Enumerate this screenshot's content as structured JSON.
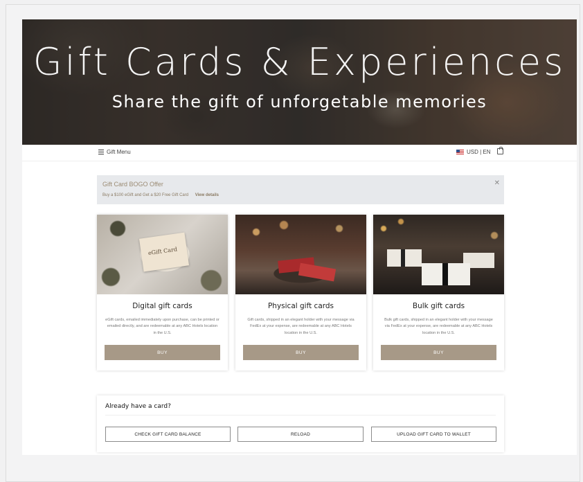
{
  "hero": {
    "title": "Gift Cards & Experiences",
    "subtitle": "Share the gift of unforgetable memories"
  },
  "topbar": {
    "menu_label": "Gift Menu",
    "locale_label": "USD | EN",
    "icons": [
      "menu-icon",
      "us-flag-icon",
      "cart-icon"
    ]
  },
  "banner": {
    "title": "Gift Card BOGO Offer",
    "text": "Buy a $100 eGift and Get a $20 Free Gift Card",
    "link": "View details",
    "close": "✕"
  },
  "cards": [
    {
      "image_text": "eGift Card",
      "title": "Digital gift cards",
      "description": "eGift cards, emailed immediately upon purchase, can be printed or emailed directly, and are redeemable at any ABC Hotels location in the U.S.",
      "button": "BUY"
    },
    {
      "title": "Physical gift cards",
      "description": "Gift cards, shipped in an elegant holder with your message via FedEx at your expense, are redeemable at any ABC Hotels location in the U.S.",
      "button": "BUY"
    },
    {
      "title": "Bulk gift cards",
      "description": "Bulk gift cards, shipped in an elegant holder with your message via FedEx at your expense, are redeemable at any ABC Hotels location in the U.S.",
      "button": "BUY"
    }
  ],
  "have_card": {
    "title": "Already have a card?",
    "buttons": [
      "CHECK GIFT CARD BALANCE",
      "RELOAD",
      "UPLOAD GIFT CARD TO WALLET"
    ]
  },
  "colors": {
    "accent": "#a79987",
    "banner_bg": "#e7e9ec",
    "banner_text": "#9b8b73"
  }
}
